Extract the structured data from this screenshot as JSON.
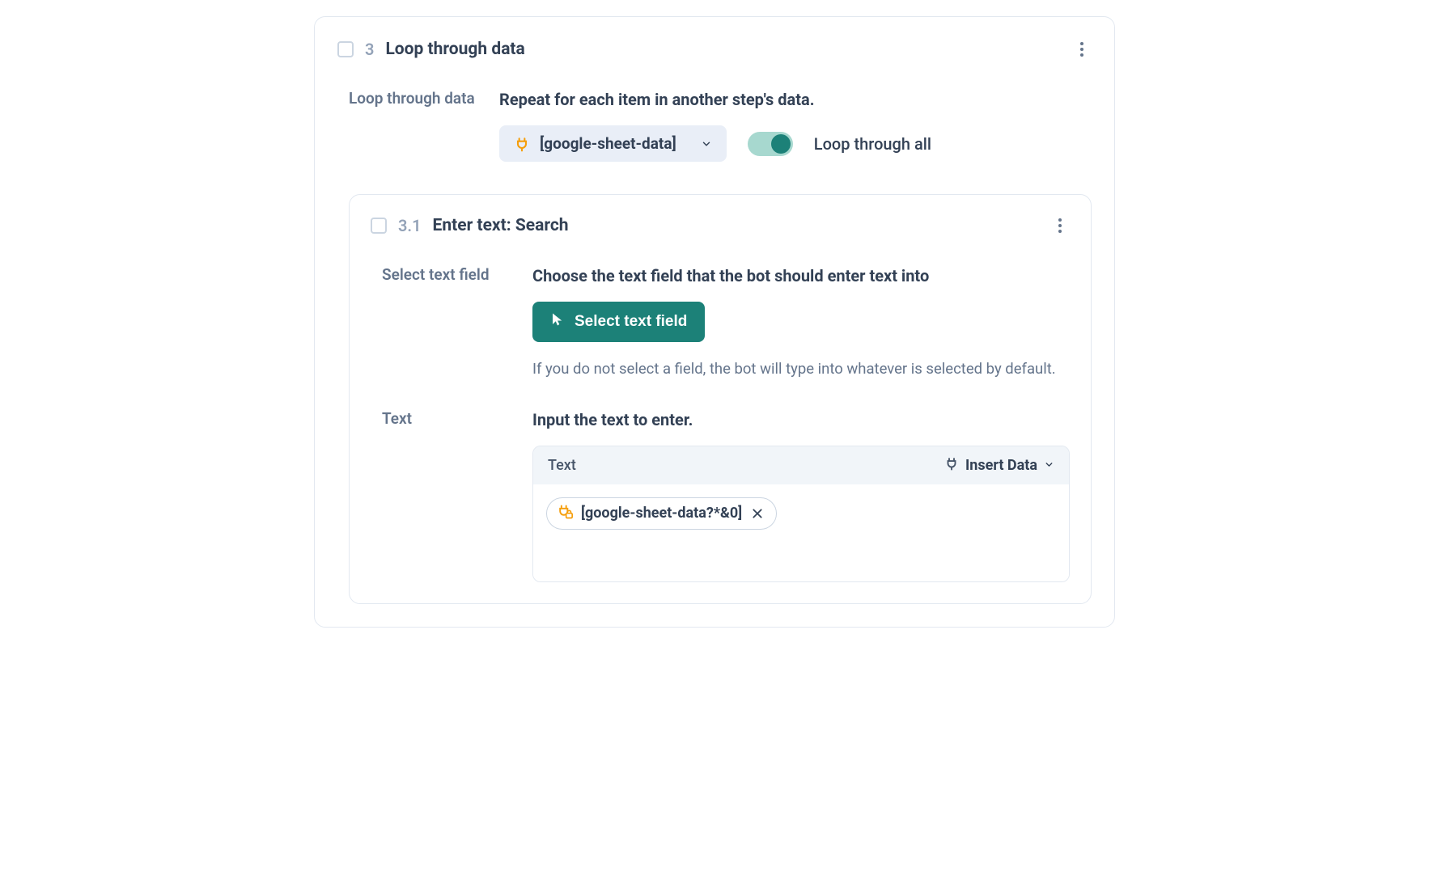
{
  "step3": {
    "number": "3",
    "title": "Loop through data",
    "loop": {
      "label": "Loop through data",
      "heading": "Repeat for each item in another step's data.",
      "source": "[google-sheet-data]",
      "toggle_label": "Loop through all",
      "toggle_on": true
    }
  },
  "step31": {
    "number": "3.1",
    "title": "Enter text: Search",
    "select_field": {
      "label": "Select text field",
      "heading": "Choose the text field that the bot should enter text into",
      "button": "Select text field",
      "helper": "If you do not select a field, the bot will type into whatever is selected by default."
    },
    "text": {
      "label": "Text",
      "heading": "Input the text to enter.",
      "panel_label": "Text",
      "insert_data_label": "Insert Data",
      "chip": "[google-sheet-data?*&0]"
    }
  },
  "colors": {
    "primary": "#1c8178",
    "plug_orange": "#f59e0b"
  }
}
